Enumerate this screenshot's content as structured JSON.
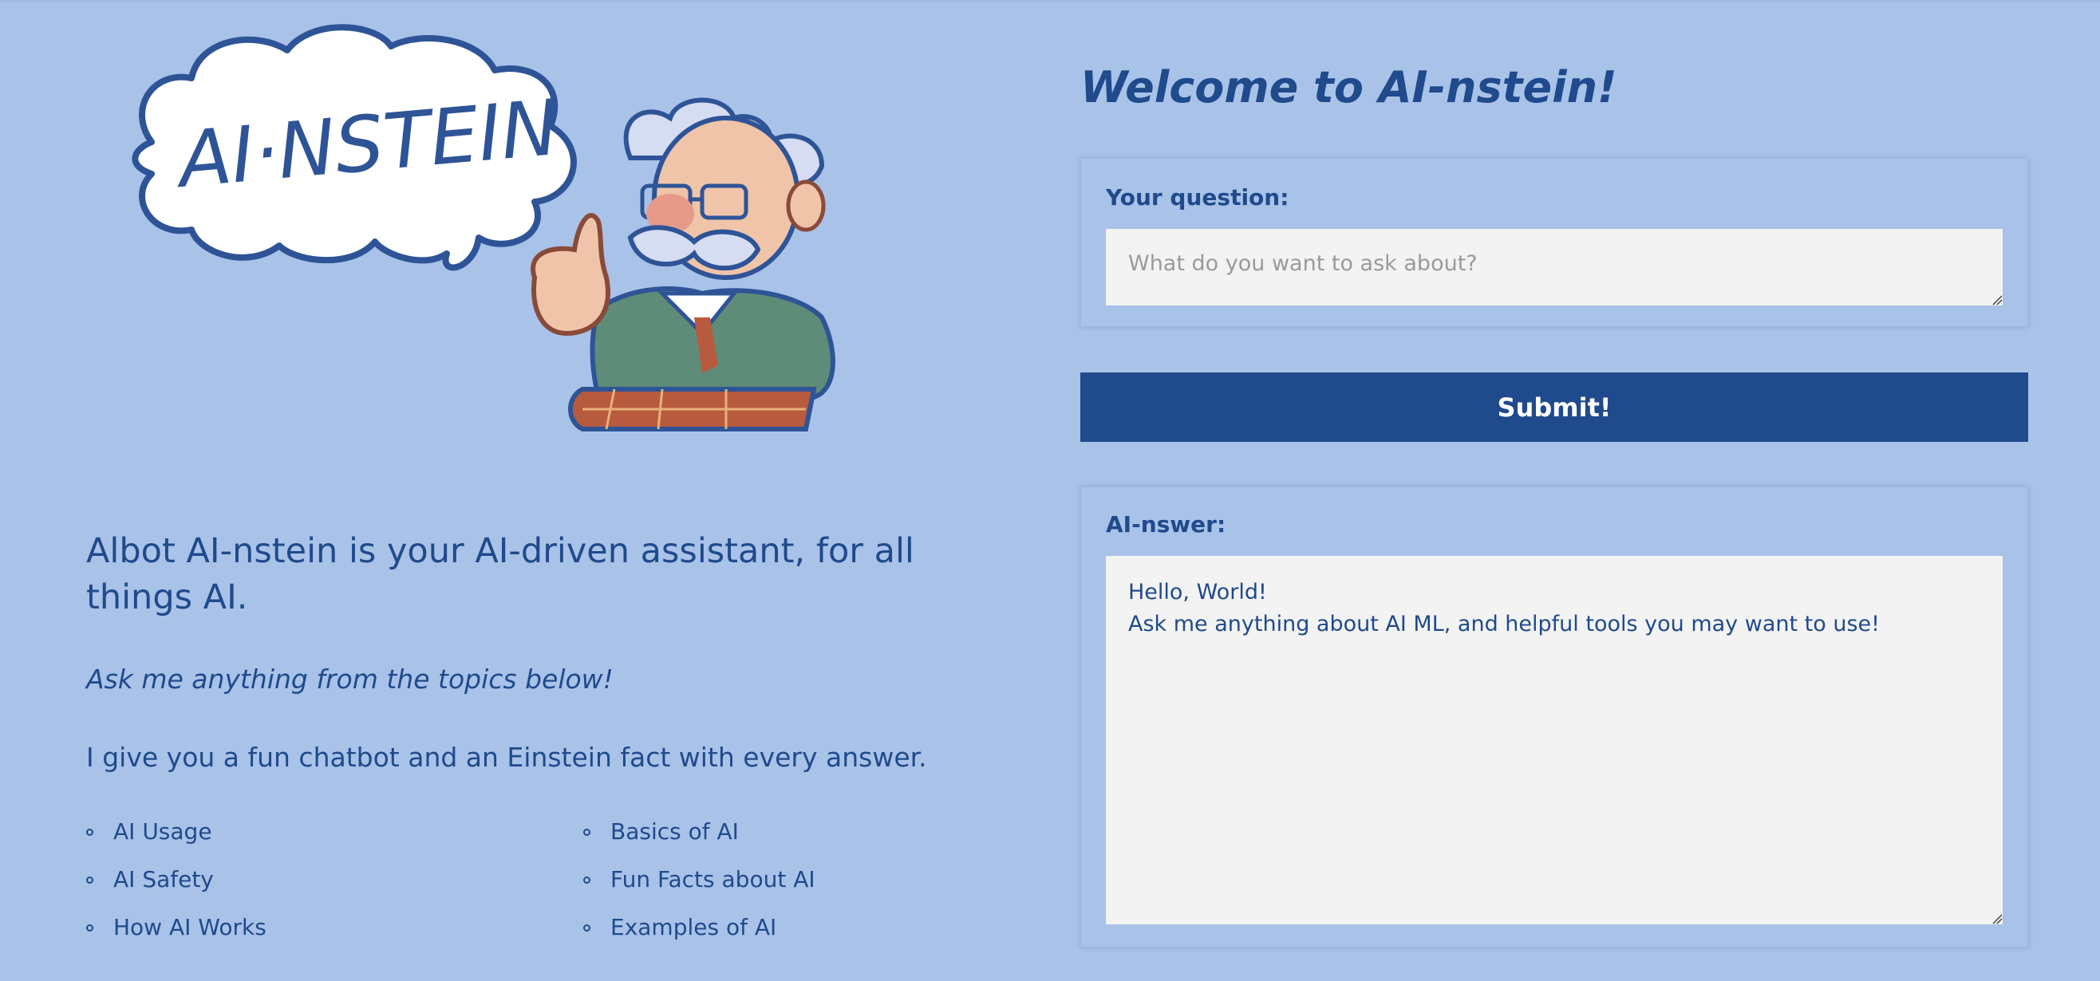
{
  "header": {
    "welcome_title": "Welcome to AI-nstein!"
  },
  "logo": {
    "bubble_text": "AI·NSTEIN",
    "icon": "einstein-character-illustration"
  },
  "intro": {
    "tagline": "Albot AI-nstein is your AI-driven assistant, for all things AI.",
    "subtitle": "Ask me anything from the topics below!",
    "fact_line": "I give you a fun chatbot and an Einstein fact with every answer."
  },
  "topics": [
    "AI Usage",
    "Basics of AI",
    "AI Safety",
    "Fun Facts about AI",
    "How AI Works",
    "Examples of AI"
  ],
  "question": {
    "label": "Your question:",
    "placeholder": "What do you want to ask about?",
    "value": ""
  },
  "submit": {
    "label": "Submit!"
  },
  "answer": {
    "label": "AI-nswer:",
    "value": "Hello, World!\nAsk me anything about AI ML, and helpful tools you may want to use!"
  },
  "colors": {
    "background": "#a9c2e8",
    "primary": "#1f4a8c",
    "textbox": "#f3f3f3"
  }
}
